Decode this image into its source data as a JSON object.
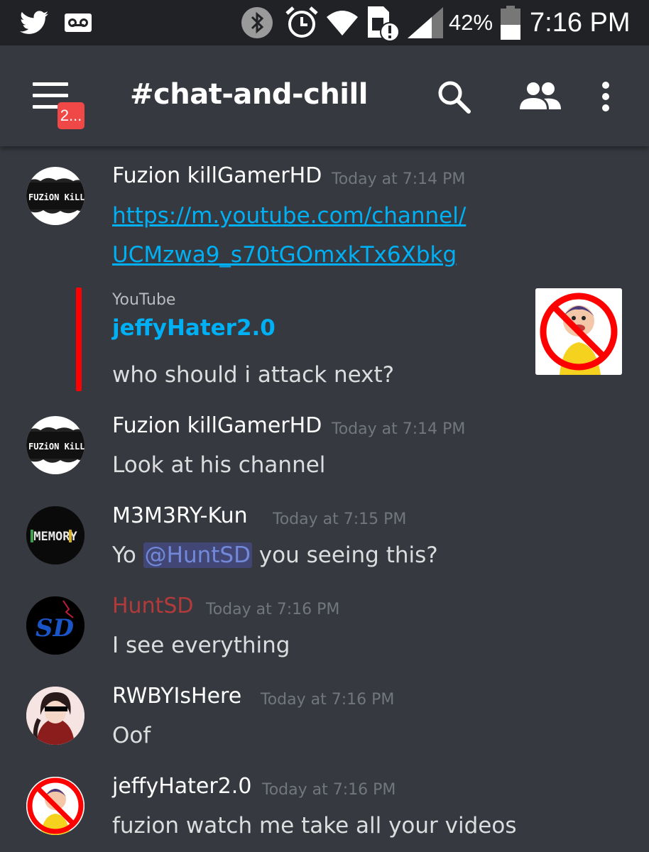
{
  "status_bar": {
    "battery": "42%",
    "time": "7:16 PM",
    "icons": [
      "twitter-icon",
      "voicemail-icon",
      "bluetooth-icon",
      "alarm-icon",
      "wifi-icon",
      "sim-alert-icon",
      "signal-icon",
      "battery-icon"
    ]
  },
  "app_bar": {
    "channel_name": "#chat-and-chill",
    "notification_badge": "2...",
    "icons": [
      "menu-icon",
      "search-icon",
      "members-icon",
      "more-vert-icon"
    ]
  },
  "colors": {
    "background": "#36393f",
    "status_bar": "#202225",
    "link": "#00b0f4",
    "embed_accent": "#ff0000",
    "mention_bg": "#414675",
    "mention_text": "#7289da",
    "role_red": "#b33a3a",
    "timestamp": "#72767d",
    "badge": "#f04747"
  },
  "messages": [
    {
      "author": "Fuzion killGamerHD",
      "timestamp": "Today at 7:14 PM",
      "avatar_text": "FUZiON KiLL",
      "link_line1": "https://m.youtube.com/channel/",
      "link_line2": "UCMzwa9_s70tGOmxkTx6Xbkg",
      "embed": {
        "provider": "YouTube",
        "title": "jeffyHater2.0",
        "description": "who should i attack next?"
      }
    },
    {
      "author": "Fuzion killGamerHD",
      "timestamp": "Today at 7:14 PM",
      "avatar_text": "FUZiON KiLL",
      "content": "Look at his channel"
    },
    {
      "author": "M3M3RY-Kun",
      "timestamp": "Today at 7:15 PM",
      "avatar_text": "MEMORY",
      "content_before": "Yo ",
      "mention": "@HuntSD",
      "content_after": " you seeing this?"
    },
    {
      "author": "HuntSD",
      "timestamp": "Today at 7:16 PM",
      "avatar_text": "SD",
      "content": "I see everything"
    },
    {
      "author": "RWBYIsHere",
      "timestamp": "Today at 7:16 PM",
      "content": "Oof"
    },
    {
      "author": "jeffyHater2.0",
      "timestamp": "Today at 7:16 PM",
      "content": "fuzion watch me take all your videos"
    }
  ]
}
